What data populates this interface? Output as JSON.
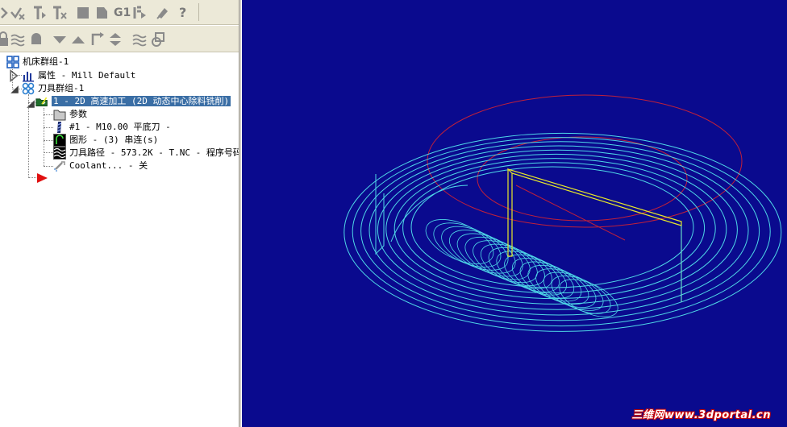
{
  "toolbar_top": {
    "icons": [
      "select-arrow-icon",
      "check-arrow-icon",
      "regen-toolpath-icon",
      "regen-dirty-icon",
      "stop-icon",
      "backplot-icon",
      "g1-icon",
      "post-icon",
      "highspeed-icon",
      "help-icon"
    ],
    "g1_label": "G1",
    "help_label": "?"
  },
  "toolbar_second": {
    "icons": [
      "lock-icon",
      "wave-icon",
      "bell-icon",
      "move-down-icon",
      "move-up-icon",
      "insert-arrow-icon",
      "expand-icon",
      "wavy-icon",
      "shapes-icon"
    ]
  },
  "tree": {
    "machine_group": "机床群组-1",
    "properties": "属性 - Mill Default",
    "toolpath_group": "刀具群组-1",
    "operation": "1 - 2D 高速加工 (2D 动态中心除料铣削)",
    "parameters": "参数",
    "tool": "#1 - M10.00 平底刀 -",
    "geometry": "图形 - (3) 串连(s)",
    "toolpath": "刀具路径 - 573.2K - T.NC - 程序号码",
    "coolant": "Coolant... - 关"
  },
  "viewport": {
    "background": "#0a0a8e",
    "toolpath_color": "#4fd8e8",
    "boundary_color": "#c0203a",
    "geometry_color": "#e6e62a"
  },
  "watermark": "三维网www.3dportal.cn"
}
